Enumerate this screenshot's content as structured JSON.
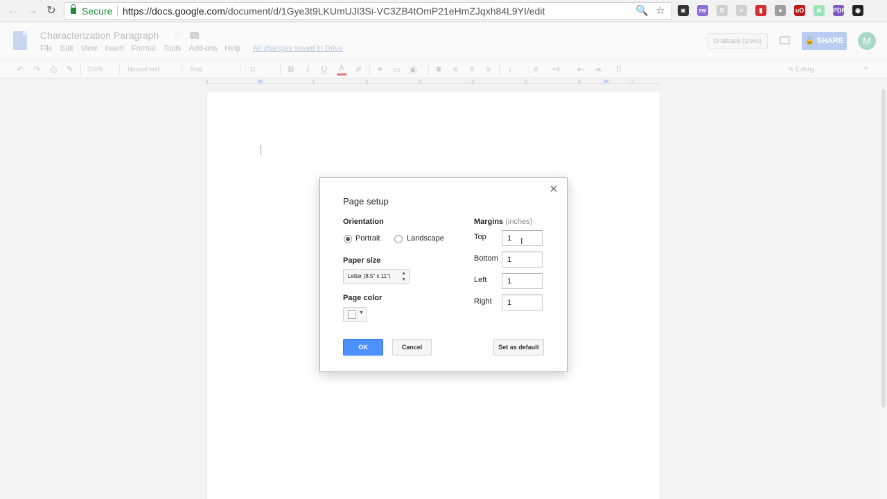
{
  "browser": {
    "back_icon": "←",
    "forward_icon": "→",
    "reload_icon": "↻",
    "secure_label": "Secure",
    "url_host": "https://docs.google.com",
    "url_path": "/document/d/1Gye3t9LKUmUJI3Si-VC3ZB4tOmP21eHmZJqxh84L9YI/edit",
    "zoom_icon": "🔍",
    "star_icon": "☆",
    "extensions": [
      {
        "name": "pocket-ext-icon",
        "glyph": "◙",
        "color": "#333333"
      },
      {
        "name": "rw-ext-icon",
        "glyph": "rw",
        "color": "#8e6dd9"
      },
      {
        "name": "d-ext-icon",
        "glyph": "D",
        "color": "#cfcfcf"
      },
      {
        "name": "scribble-ext-icon",
        "glyph": "≈",
        "color": "#cfcfcf"
      },
      {
        "name": "book-ext-icon",
        "glyph": "▮",
        "color": "#d32f2f"
      },
      {
        "name": "bubble-ext-icon",
        "glyph": "●",
        "color": "#9e9e9e"
      },
      {
        "name": "ublock-ext-icon",
        "glyph": "uO",
        "color": "#b71c1c"
      },
      {
        "name": "wave-ext-icon",
        "glyph": "≋",
        "color": "#9be3b8"
      },
      {
        "name": "pdf-ext-icon",
        "glyph": "PDF",
        "color": "#7e57c2"
      },
      {
        "name": "spy-ext-icon",
        "glyph": "◉",
        "color": "#222222"
      }
    ]
  },
  "docs": {
    "title": "Characterization Paragraph",
    "star_icon": "☆",
    "menus": [
      "File",
      "Edit",
      "View",
      "Insert",
      "Format",
      "Tools",
      "Add-ons",
      "Help"
    ],
    "saved_status": "All changes saved in Drive",
    "draftback_label": "Draftback (1revs)",
    "share_label": "🔒 SHARE",
    "avatar_initial": "M"
  },
  "toolbar": {
    "undo_icon": "↶",
    "redo_icon": "↷",
    "print_icon": "⎙",
    "paint_icon": "✎",
    "zoom": "100%",
    "style": "Normal text",
    "font": "Arial",
    "size": "11",
    "bold": "B",
    "italic": "I",
    "underline": "U",
    "text_color": "A",
    "highlight_icon": "✐",
    "link_icon": "⚭",
    "comment_icon": "▭",
    "image_icon": "▣",
    "align_left": "≡",
    "align_center": "≡",
    "align_right": "≡",
    "align_justify": "≡",
    "line_spacing": "↕",
    "numbered_list": "⋮≡",
    "bulleted_list": "•≡",
    "indent_less": "⇤",
    "indent_more": "⇥",
    "clear_format": "T̸",
    "mode": "✎ Editing",
    "collapse_icon": "^"
  },
  "ruler": {
    "numbers": [
      "1",
      "1",
      "2",
      "3",
      "4",
      "5",
      "6",
      "7"
    ]
  },
  "dialog": {
    "title": "Page setup",
    "close_icon": "✕",
    "orientation_label": "Orientation",
    "portrait_label": "Portrait",
    "landscape_label": "Landscape",
    "orientation_selected": "Portrait",
    "paper_size_label": "Paper size",
    "paper_size_value": "Letter (8.5\" x 11\")",
    "page_color_label": "Page color",
    "page_color_value": "#ffffff",
    "margins_label": "Margins",
    "margins_unit": "(inches)",
    "margins": {
      "top_label": "Top",
      "top_value": "1",
      "bottom_label": "Bottom",
      "bottom_value": "1",
      "left_label": "Left",
      "left_value": "1",
      "right_label": "Right",
      "right_value": "1"
    },
    "ok_label": "OK",
    "cancel_label": "Cancel",
    "default_label": "Set as default"
  }
}
